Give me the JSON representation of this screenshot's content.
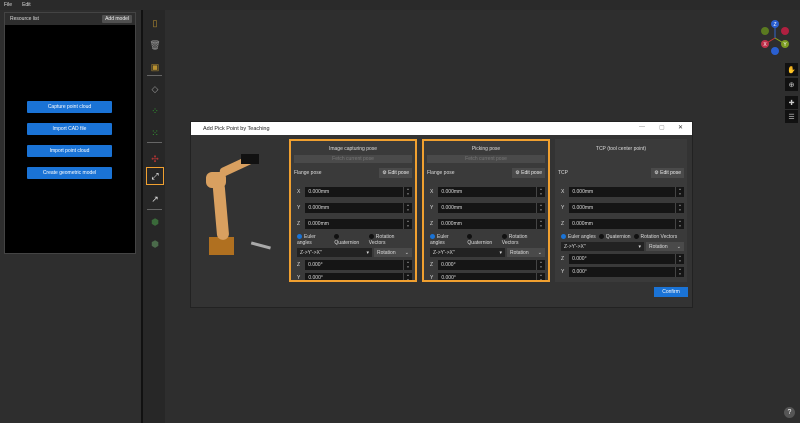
{
  "menu": [
    "File",
    "Edit"
  ],
  "resource": {
    "title": "Resource list",
    "add_model": "Add model",
    "buttons": [
      "Capture point cloud",
      "Import CAD file",
      "Import point cloud",
      "Create geometric model"
    ]
  },
  "dialog": {
    "title": "Add Pick Point by Teaching",
    "confirm": "Confirm",
    "panels": [
      {
        "title": "Image capturing pose",
        "fetch": "Fetch current pose",
        "pose_label": "Flange pose",
        "edit": "Edit pose",
        "x": "0.000mm",
        "y": "0.000mm",
        "z": "0.000mm",
        "angle1": "0.000°",
        "angle2": "0.000°"
      },
      {
        "title": "Picking pose",
        "fetch": "Fetch current pose",
        "pose_label": "Flange pose",
        "edit": "Edit pose",
        "x": "0.000mm",
        "y": "0.000mm",
        "z": "0.000mm",
        "angle1": "0.000°",
        "angle2": "0.000°"
      },
      {
        "title": "TCP (tool center point)",
        "pose_label": "TCP",
        "edit": "Edit pose",
        "x": "0.000mm",
        "y": "0.000mm",
        "z": "0.000mm",
        "angle1": "0.000°",
        "angle2": "0.000°"
      }
    ],
    "axis_labels": [
      "X",
      "Y",
      "Z",
      "Z",
      "Y"
    ],
    "radio": [
      "Euler angles",
      "Quaternion",
      "Rotation Vectors"
    ],
    "order": "Z->Y'->X''",
    "rotation": "Rotation"
  },
  "gizmo": [
    "Z",
    "X",
    "Y"
  ],
  "help": "?",
  "colors": {
    "accent": "#1a73d6",
    "highlight": "#f0a030"
  }
}
